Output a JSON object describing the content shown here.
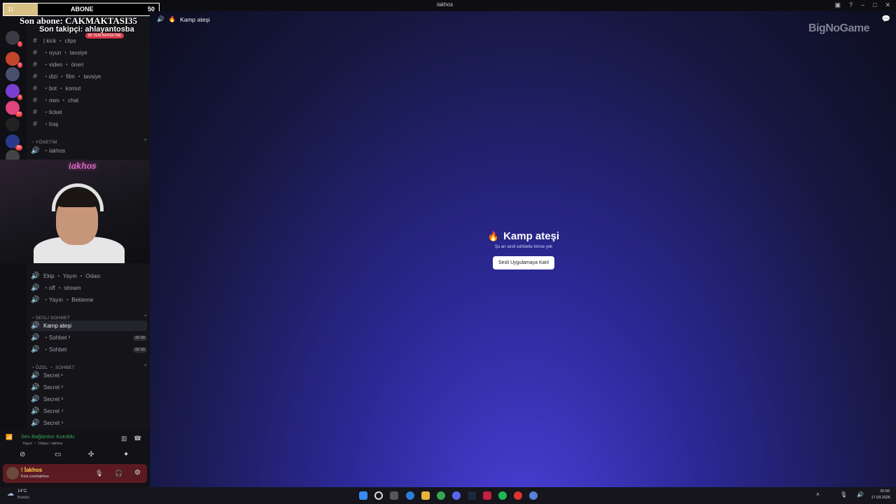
{
  "window": {
    "title": "iakhos"
  },
  "overlay": {
    "counter_left": "11",
    "counter_label": "ABONE",
    "counter_right": "50",
    "counter_fill": 0.22,
    "last_sub": "Son abone: CAKMAKTASI35",
    "last_follower": "Son takipçi: ahlayantosba",
    "promo_badge": "80 YENİ BAHSETME"
  },
  "servers": [
    {
      "badge": "1",
      "color": "#3a3a44"
    },
    {
      "badge": "6",
      "color": "#c2452b"
    },
    {
      "badge": "",
      "color": "#4a4f6b"
    },
    {
      "badge": "4",
      "color": "#7a3fd0"
    },
    {
      "badge": "27",
      "color": "#e0457b"
    },
    {
      "badge": "",
      "color": "#222"
    },
    {
      "badge": "80",
      "color": "#2a3a8a"
    },
    {
      "badge": "",
      "color": "#444"
    }
  ],
  "channels_top": [
    {
      "icon": "#",
      "label": "| kick ・ clips"
    },
    {
      "icon": "#",
      "label": "・oyun ・ tavsiye"
    },
    {
      "icon": "#",
      "label": "・video ・ öneri"
    },
    {
      "icon": "#",
      "label": "・dizi ・ film ・ tavsiye"
    },
    {
      "icon": "#",
      "label": "・bot ・ komut"
    },
    {
      "icon": "#",
      "label": "・owo ・ chat"
    },
    {
      "icon": "#",
      "label": "・ticket"
    },
    {
      "icon": "#",
      "label": "・traş"
    }
  ],
  "category_admin": "・YÖNETİM",
  "admin_channel": "・iakhos",
  "channels_voice": [
    {
      "label": "Ekip ・ Yayın ・ Odası"
    },
    {
      "label": "・off ・ stream"
    },
    {
      "label": "・Yayın ・ Bekleme"
    }
  ],
  "category_voice": "・SESLİ SOHBET",
  "voice_chats": [
    {
      "label": "Kamp ateşi",
      "active": true,
      "count": ""
    },
    {
      "label": "・Sohbet ²",
      "count": "00 99"
    },
    {
      "label": "・Sohbet",
      "count": "00 99"
    }
  ],
  "category_private": "・ÖZEL ・ SOHBET",
  "private_chats": [
    "Secret ¹",
    "Secret ²",
    "Secret ³",
    "Secret ⁴",
    "Secret ⁵"
  ],
  "voice_status": {
    "title": "Ses Bağlantısı Kuruldu",
    "sub": "Yayın ・ Odası / iakhos"
  },
  "user": {
    "name": "! İakhos",
    "status": "Kick.com/iakhos"
  },
  "main": {
    "channel_title": "Kamp ateşi",
    "center_title": "Kamp ateşi",
    "center_sub": "Şu an sesli sohbette kimse yok",
    "join_label": "Sesli Uygulamaya Katıl",
    "watermark": "BigNoGame"
  },
  "taskbar": {
    "weather_temp": "14°C",
    "weather_desc": "Bulutlu",
    "time": "20:50",
    "date": "17.03.2026"
  },
  "colors": {
    "accent": "#5865f2",
    "brand_red": "#f23f43"
  }
}
